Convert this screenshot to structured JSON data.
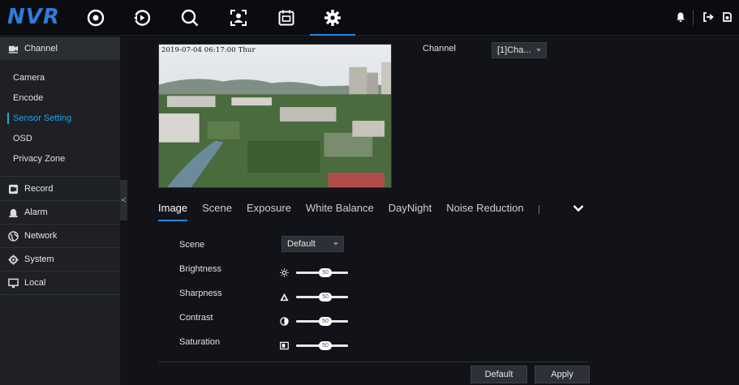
{
  "app": {
    "logo": "NVR"
  },
  "topnav": {
    "icons": [
      "live-view-icon",
      "playback-icon",
      "search-icon",
      "person-detect-icon",
      "calendar-icon",
      "settings-icon"
    ],
    "active": "settings-icon",
    "right_icons": [
      "bell-icon",
      "logout-icon",
      "shutdown-icon"
    ]
  },
  "sidebar": {
    "channel": "Channel",
    "channel_items": [
      "Camera",
      "Encode",
      "Sensor Setting",
      "OSD",
      "Privacy Zone"
    ],
    "active_item": "Sensor Setting",
    "groups": [
      "Record",
      "Alarm",
      "Network",
      "System",
      "Local"
    ]
  },
  "preview": {
    "timestamp": "2019-07-04 06:17:00 Thur"
  },
  "channel_select": {
    "label": "Channel",
    "value": "[1]Cha..."
  },
  "tabs": [
    "Image",
    "Scene",
    "Exposure",
    "White Balance",
    "DayNight",
    "Noise Reduction"
  ],
  "active_tab": "Image",
  "settings": {
    "scene": {
      "label": "Scene",
      "value": "Default"
    },
    "brightness": {
      "label": "Brightness",
      "value": "50"
    },
    "sharpness": {
      "label": "Sharpness",
      "value": "50"
    },
    "contrast": {
      "label": "Contrast",
      "value": "50"
    },
    "saturation": {
      "label": "Saturation",
      "value": "50"
    }
  },
  "buttons": {
    "default": "Default",
    "apply": "Apply"
  },
  "colors": {
    "accent": "#1e88e5",
    "active_text": "#21a2e8",
    "logo": "#2f7bd8"
  }
}
